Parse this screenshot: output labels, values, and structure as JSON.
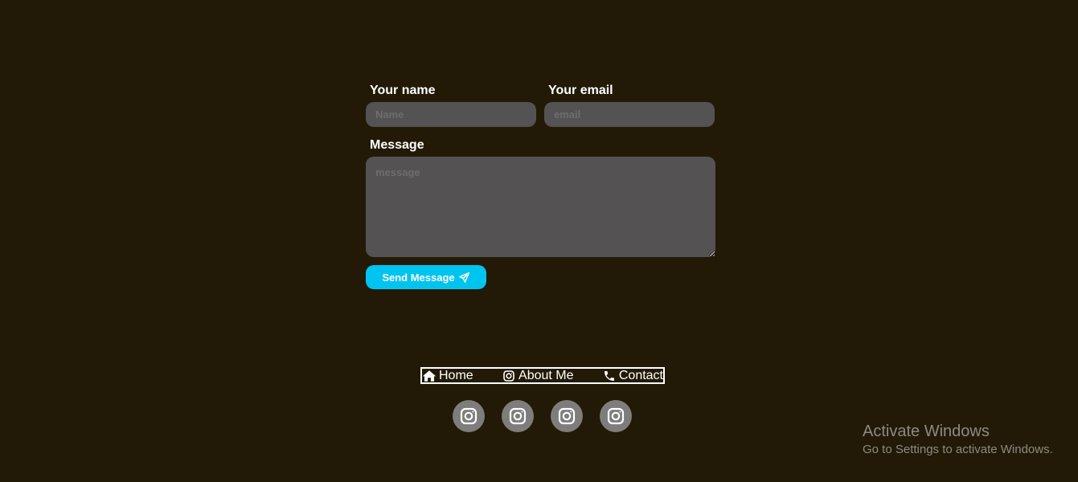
{
  "form": {
    "name_label": "Your name",
    "name_placeholder": "Name",
    "email_label": "Your email",
    "email_placeholder": "email",
    "message_label": "Message",
    "message_placeholder": "message",
    "send_label": "Send Message",
    "send_icon": "paper-plane-icon",
    "accent_color": "#00c4f0",
    "field_bg": "#545253"
  },
  "nav": {
    "items": [
      {
        "label": "Home",
        "icon": "home-icon"
      },
      {
        "label": "About Me",
        "icon": "instagram-icon"
      },
      {
        "label": "Contact",
        "icon": "phone-icon"
      }
    ]
  },
  "socials": [
    {
      "icon": "instagram-icon"
    },
    {
      "icon": "instagram-icon"
    },
    {
      "icon": "instagram-icon"
    },
    {
      "icon": "instagram-icon"
    }
  ],
  "watermark": {
    "title": "Activate Windows",
    "subtitle": "Go to Settings to activate Windows."
  },
  "colors": {
    "background": "#221a06",
    "social_bg": "#7e7d7b"
  }
}
